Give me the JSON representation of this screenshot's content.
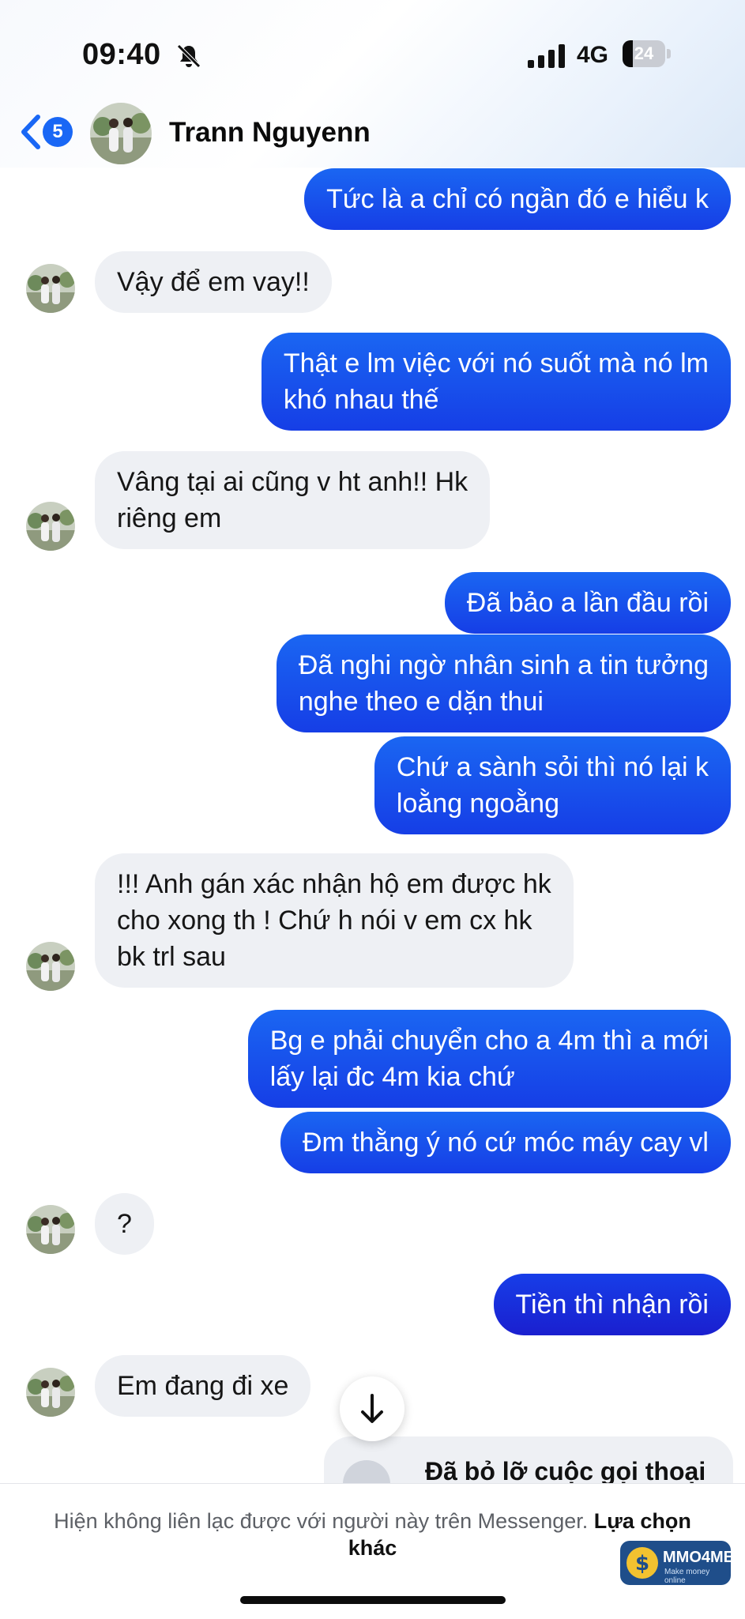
{
  "status_bar": {
    "time": "09:40",
    "network": "4G",
    "battery": "24",
    "battery_fraction": 0.24
  },
  "header": {
    "back_badge": "5",
    "contact_name": "Trann Nguyenn"
  },
  "messages": [
    {
      "side": "out",
      "text": "Tức là a chỉ có ngần đó e hiểu k"
    },
    {
      "side": "in",
      "text": "Vậy để em vay!!"
    },
    {
      "side": "out",
      "text": "Thật e lm việc với nó suốt mà nó lm\nkhó nhau thế"
    },
    {
      "side": "in",
      "text": "Vâng tại ai cũng v ht anh!! Hk\nriêng em"
    },
    {
      "side": "out",
      "text": "Đã bảo a lần đầu rồi"
    },
    {
      "side": "out",
      "text": "Đã nghi ngờ nhân sinh a tin tưởng\nnghe theo e dặn thui"
    },
    {
      "side": "out",
      "text": "Chứ a sành sỏi thì nó lại k\nloằng ngoằng"
    },
    {
      "side": "in",
      "text": "!!! Anh gán xác nhận hộ em được hk\ncho xong th ! Chứ h nói v em cx hk\nbk trl sau"
    },
    {
      "side": "out",
      "text": "Bg e phải chuyển cho a 4m thì a mới\nlấy lại đc 4m kia chứ"
    },
    {
      "side": "out",
      "text": "Đm thằng ý nó cứ móc máy cay vl"
    },
    {
      "side": "in",
      "text": "?"
    },
    {
      "side": "out",
      "text": "Tiền thì nhận rồi"
    },
    {
      "side": "in",
      "text": "Em đang đi xe"
    }
  ],
  "missed_call": {
    "text": "Đã bỏ lỡ cuộc gọi thoại"
  },
  "footer": {
    "notice": "Hiện không liên lạc được với người này trên Messenger.",
    "link": "Lựa chọn khác"
  },
  "watermark": {
    "brand": "MMO4ME",
    "tagline": "Make money online"
  },
  "colors": {
    "outgoing": "#1a5cf0",
    "incoming": "#eef0f4",
    "accent": "#1967f5"
  }
}
